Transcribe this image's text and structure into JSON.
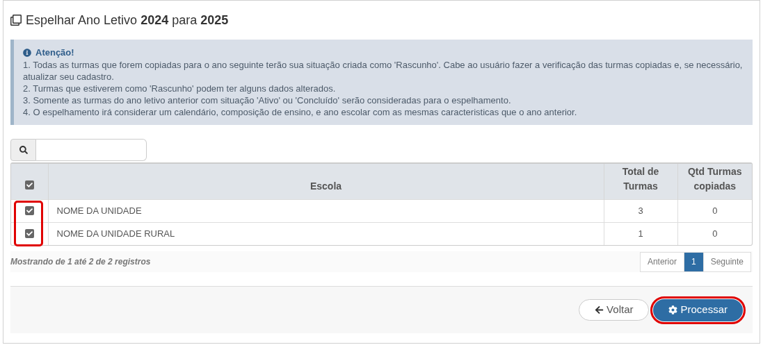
{
  "title": {
    "prefix": "Espelhar Ano Letivo",
    "from_year": "2024",
    "middle": "para",
    "to_year": "2025"
  },
  "alert": {
    "heading": "Atenção!",
    "lines": [
      "1. Todas as turmas que forem copiadas para o ano seguinte terão sua situação criada como 'Rascunho'. Cabe ao usuário fazer a verificação das turmas copiadas e, se necessário, atualizar seu cadastro.",
      "2. Turmas que estiverem como 'Rascunho' podem ter alguns dados alterados.",
      "3. Somente as turmas do ano letivo anterior com situação 'Ativo' ou 'Concluído' serão consideradas para o espelhamento.",
      "4. O espelhamento irá considerar um calendário, composição de ensino, e ano escolar com as mesmas caracteristicas que o ano anterior."
    ]
  },
  "table": {
    "select_all_checked": true,
    "columns": [
      "Escola",
      "Total de Turmas",
      "Qtd Turmas copiadas"
    ],
    "rows": [
      {
        "checked": true,
        "escola": "NOME DA UNIDADE",
        "total": "3",
        "copiadas": "0"
      },
      {
        "checked": true,
        "escola": "NOME DA UNIDADE RURAL",
        "total": "1",
        "copiadas": "0"
      }
    ]
  },
  "info": "Mostrando de 1 até 2 de 2 registros",
  "pagination": [
    {
      "label": "Anterior",
      "selected": false
    },
    {
      "label": "1",
      "selected": true
    },
    {
      "label": "Seguinte",
      "selected": false
    }
  ],
  "buttons": {
    "back": "Voltar",
    "process": "Processar"
  },
  "highlights": {
    "row_checkboxes": true,
    "process_button": true
  }
}
